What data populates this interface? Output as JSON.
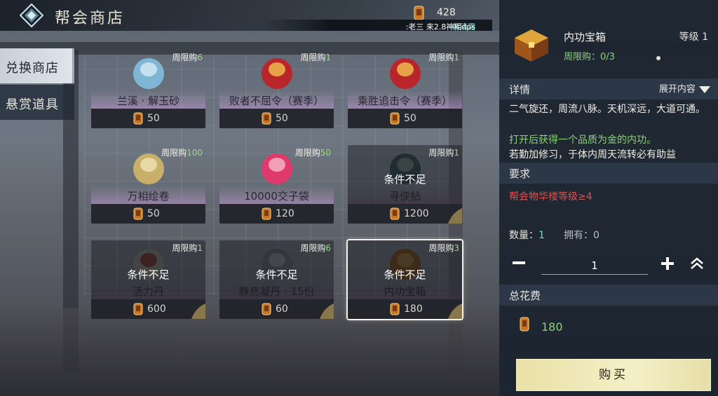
{
  "header": {
    "title": "帮会商店",
    "currency_value": "428",
    "marquee_name": "解清霜",
    "marquee_text": ":老三 来2.8神相dps"
  },
  "tabs": [
    {
      "label": "兑换商店",
      "active": true
    },
    {
      "label": "悬赏道具",
      "active": false
    }
  ],
  "items": [
    {
      "name": "兰溪 · 解玉砂",
      "limit_label": "周限购",
      "limit_num": "6",
      "price": "50",
      "locked": false
    },
    {
      "name": "败者不屈令（赛季）",
      "limit_label": "周限购",
      "limit_num": "1",
      "price": "50",
      "locked": false
    },
    {
      "name": "乘胜追击令（赛季）",
      "limit_label": "周限购",
      "limit_num": "1",
      "price": "50",
      "locked": false
    },
    {
      "name": "万相绘卷",
      "limit_label": "周限购",
      "limit_num": "100",
      "price": "50",
      "locked": false
    },
    {
      "name": "10000交子袋",
      "limit_label": "周限购",
      "limit_num": "50",
      "price": "120",
      "locked": false
    },
    {
      "name": "寻侠帖",
      "limit_label": "周限购",
      "limit_num": "1",
      "price": "1200",
      "locked": true,
      "lock_text": "条件不足"
    },
    {
      "name": "活力丹",
      "limit_label": "周限购",
      "limit_num": "1",
      "price": "600",
      "locked": true,
      "lock_text": "条件不足"
    },
    {
      "name": "静息凝丹 · 15份",
      "limit_label": "周限购",
      "limit_num": "6",
      "price": "60",
      "locked": true,
      "lock_text": "条件不足"
    },
    {
      "name": "内功宝箱",
      "limit_label": "周限购",
      "limit_num": "3",
      "price": "180",
      "locked": true,
      "lock_text": "条件不足",
      "selected": true
    }
  ],
  "detail": {
    "name": "内功宝箱",
    "level": "等级 1",
    "limit": "周限购：0/3",
    "section_detail": "详情",
    "expand_label": "展开内容",
    "desc_line1": "二气旋还，周流八脉。天机深远，大道可通。",
    "desc_line2": "打开后获得一个品质为金的内功。",
    "desc_line3": "若勤加修习，于体内周天流转必有助益",
    "section_require": "要求",
    "requirement": "帮会物华楼等级≥4",
    "qty_label": "数量：",
    "qty_value": "1",
    "owned": "拥有：0",
    "qty_input": "1",
    "section_total": "总花费",
    "total": "180",
    "buy_label": "购买"
  },
  "icons": {
    "currency": "currency-token-icon",
    "logo": "diamond-logo-icon"
  },
  "colors": {
    "limit_green": "#9ad97a",
    "require_red": "#d9534f",
    "buy_button": "#f4efc8"
  }
}
